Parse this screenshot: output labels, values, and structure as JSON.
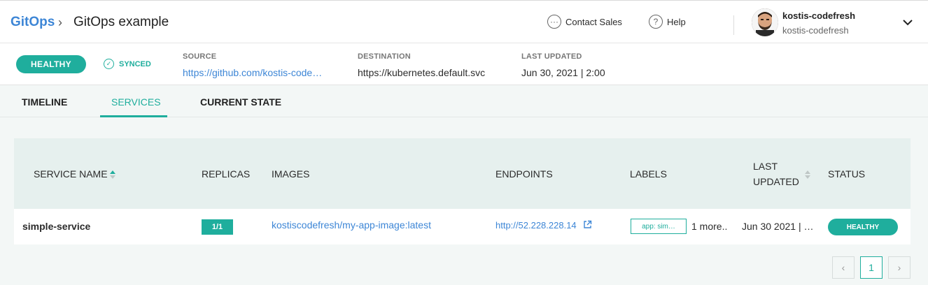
{
  "header": {
    "breadcrumb_root": "GitOps",
    "breadcrumb_separator": "›",
    "title": "GitOps example",
    "contact_sales_label": "Contact Sales",
    "help_label": "Help",
    "user_name": "kostis-codefresh",
    "user_org": "kostis-codefresh",
    "icons": [
      "chat-icon",
      "help-icon",
      "avatar",
      "chevron-down-icon"
    ]
  },
  "summary": {
    "health_status": "HEALTHY",
    "sync_status": "SYNCED",
    "source_label": "SOURCE",
    "source_value": "https://github.com/kostis-code…",
    "destination_label": "DESTINATION",
    "destination_value": "https://kubernetes.default.svc",
    "last_updated_label": "LAST UPDATED",
    "last_updated_value": "Jun 30, 2021 | 2:00"
  },
  "tabs": [
    {
      "label": "TIMELINE",
      "active": false
    },
    {
      "label": "SERVICES",
      "active": true
    },
    {
      "label": "CURRENT STATE",
      "active": false
    }
  ],
  "table": {
    "columns": {
      "service_name": "SERVICE NAME",
      "replicas": "REPLICAS",
      "images": "IMAGES",
      "endpoints": "ENDPOINTS",
      "labels": "LABELS",
      "last_updated_line1": "LAST",
      "last_updated_line2": "UPDATED",
      "status": "STATUS"
    },
    "rows": [
      {
        "service_name": "simple-service",
        "replicas": "1/1",
        "image": "kostiscodefresh/my-app-image:latest",
        "endpoint": "http://52.228.228.14",
        "label_chip": "app: sim…",
        "more_labels": "1 more..",
        "last_updated": "Jun 30 2021 | …",
        "status": "HEALTHY"
      }
    ]
  },
  "pagination": {
    "prev": "‹",
    "current_page": "1",
    "next": "›"
  },
  "colors": {
    "accent": "#1fae9d",
    "link": "#3d86d6",
    "background": "#f3f7f6",
    "table_header": "#e6f0ee"
  }
}
